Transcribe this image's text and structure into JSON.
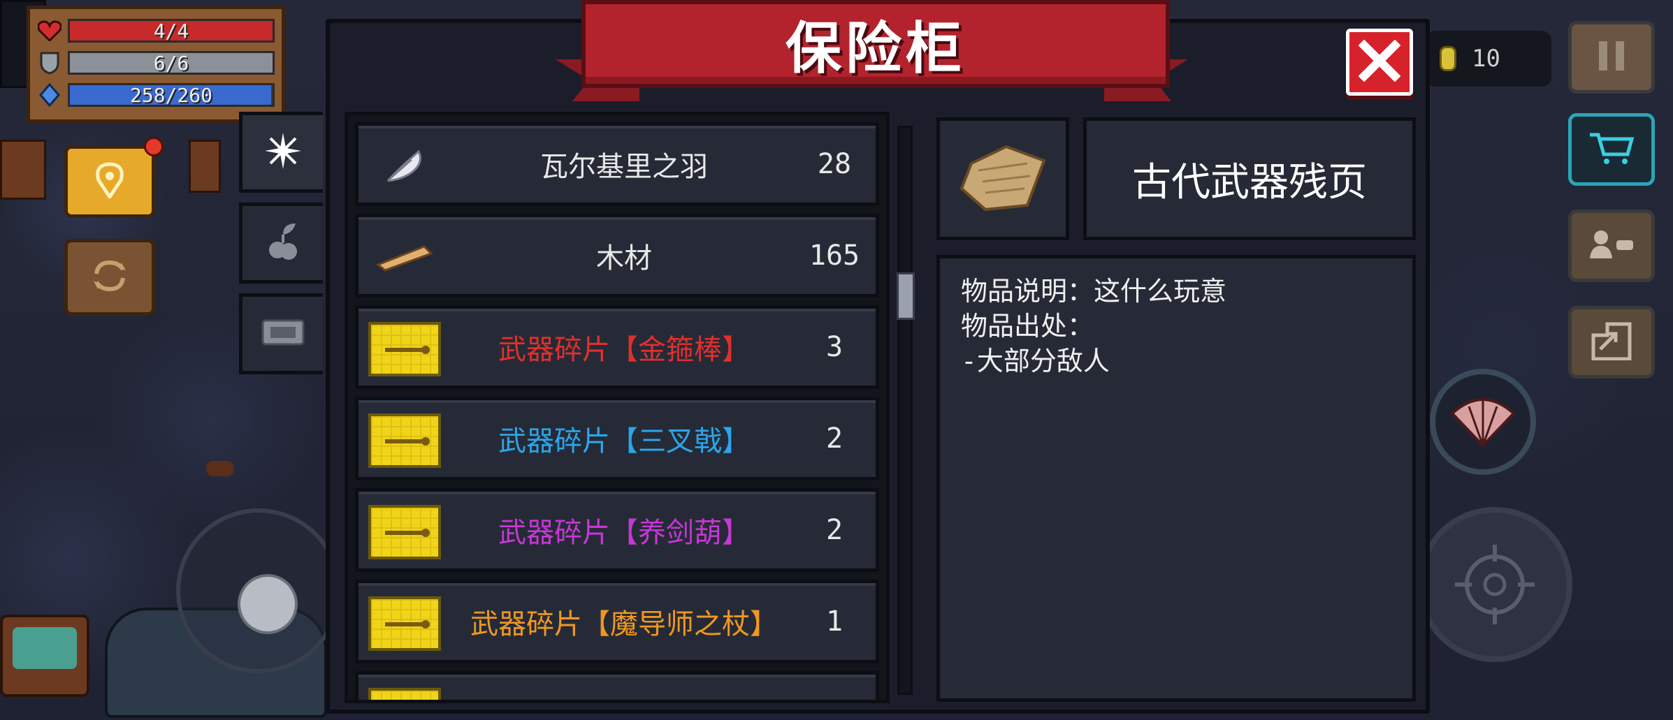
{
  "hud": {
    "hp": "4/4",
    "armor": "6/6",
    "energy": "258/260",
    "hp_fill": 1.0,
    "armor_fill": 1.0,
    "energy_fill": 0.992,
    "coins": "10"
  },
  "safe": {
    "title": "保险柜",
    "category_tabs": [
      {
        "icon": "sparkle-icon"
      },
      {
        "icon": "plant-seed-icon"
      },
      {
        "icon": "ticket-icon"
      }
    ],
    "items": [
      {
        "name": "瓦尔基里之羽",
        "count": "28",
        "color": "#e8e8e8",
        "icon": "feather-icon"
      },
      {
        "name": "木材",
        "count": "165",
        "color": "#e8e8e8",
        "icon": "wood-plank-icon"
      },
      {
        "name": "武器碎片【金箍棒】",
        "count": "3",
        "color": "#e0302e",
        "icon": "weapon-fragment-icon"
      },
      {
        "name": "武器碎片【三叉戟】",
        "count": "2",
        "color": "#2aa6ea",
        "icon": "weapon-fragment-icon"
      },
      {
        "name": "武器碎片【养剑葫】",
        "count": "2",
        "color": "#c637d6",
        "icon": "weapon-fragment-icon"
      },
      {
        "name": "武器碎片【魔导师之杖】",
        "count": "1",
        "color": "#ee9822",
        "icon": "weapon-fragment-icon"
      }
    ],
    "detail": {
      "name": "古代武器残页",
      "icon": "ancient-page-icon",
      "desc_lines": [
        "物品说明：这什么玩意",
        "物品出处：",
        "-大部分敌人"
      ]
    }
  }
}
